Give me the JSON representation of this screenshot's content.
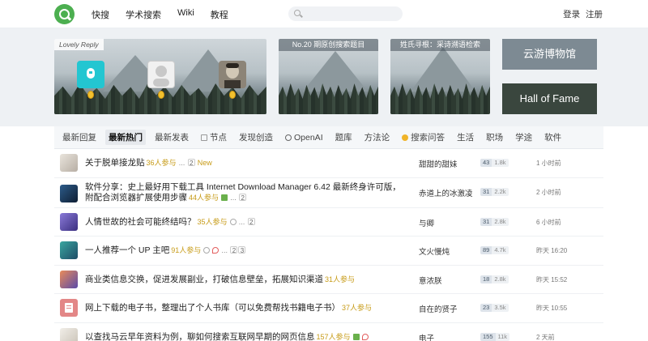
{
  "header": {
    "nav": [
      "快搜",
      "学术搜索",
      "Wiki",
      "教程"
    ],
    "search_placeholder": "",
    "login": "登录",
    "register": "注册"
  },
  "banner": {
    "card1_label": "Lovely Reply",
    "card2_label": "No.20 期原创搜索题目",
    "card3_label": "姓氏寻根：采诗溯语检索",
    "museum_button": "云游博物馆",
    "fame_button": "Hall of Fame"
  },
  "tabs": [
    "最新回复",
    "最新热门",
    "最新发表",
    "节点",
    "发现创造",
    "OpenAI",
    "题库",
    "方法论",
    "搜索问答",
    "生活",
    "职场",
    "学途",
    "软件"
  ],
  "active_tab": 1,
  "topics": [
    {
      "title": "关于脱单接龙贴",
      "count": "36人参与",
      "pages": [
        "2"
      ],
      "new": "New",
      "node": "甜甜的甜妹",
      "replies": "43",
      "views": "1.8k",
      "time": "1 小时前"
    },
    {
      "title": "软件分享：史上最好用下载工具 Internet Download Manager 6.42 最新终身许可版，附配合浏览器扩展使用步骤",
      "count": "44人参与",
      "pages": [
        "2"
      ],
      "new": "",
      "node": "赤道上的冰激凌",
      "replies": "31",
      "views": "2.2k",
      "time": "2 小时前"
    },
    {
      "title": "人情世故的社会可能终结吗？",
      "count": "35人参与",
      "pages": [
        "2"
      ],
      "new": "",
      "node": "与卿",
      "replies": "31",
      "views": "2.8k",
      "time": "6 小时前"
    },
    {
      "title": "一人推荐一个 UP 主吧",
      "count": "91人参与",
      "pages": [
        "2",
        "3"
      ],
      "new": "",
      "node": "文火慢炖",
      "replies": "89",
      "views": "4.7k",
      "time": "昨天 16:20"
    },
    {
      "title": "商业类信息交换，促进发展副业，打破信息壁垒，拓展知识渠道",
      "count": "31人参与",
      "pages": [],
      "new": "",
      "node": "意浓朕",
      "replies": "18",
      "views": "2.8k",
      "time": "昨天 15:52"
    },
    {
      "title": "网上下载的电子书，整理出了个人书库（可以免费帮找书籍电子书）",
      "count": "37人参与",
      "pages": [],
      "new": "",
      "node": "自在的贤子",
      "replies": "23",
      "views": "3.5k",
      "time": "昨天 10:55"
    },
    {
      "title": "以查找马云早年资料为例，聊如何搜索互联网早期的网页信息",
      "count": "157人参与",
      "pages": [],
      "new": "",
      "node": "电子",
      "replies": "155",
      "views": "11k",
      "time": "2 天前"
    }
  ]
}
